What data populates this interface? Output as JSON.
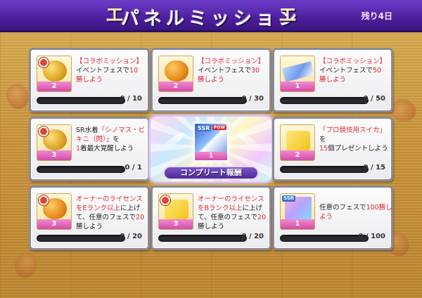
{
  "header": {
    "title": "パネルミッション",
    "remaining": "残り4日",
    "deco_glyph": "エ"
  },
  "center": {
    "reward_count": "1",
    "ssr_badge": "SSR",
    "pow_badge": "POW",
    "banner": "コンプリート報酬"
  },
  "missions": [
    {
      "icon": "gold-trophy-item",
      "has_timer": true,
      "count": "2",
      "desc": [
        "【コラボミッション】",
        "イベントフェスで",
        "10",
        "勝しよう"
      ],
      "progress": "0 / 10",
      "fill": 0
    },
    {
      "icon": "melon-item",
      "has_timer": false,
      "count": "2",
      "desc": [
        "【コラボミッション】",
        "イベントフェスで",
        "30",
        "勝しよう"
      ],
      "progress": "0 / 30",
      "fill": 0
    },
    {
      "icon": "ssr-ticket-item",
      "has_timer": false,
      "count": "1",
      "ssr": "SSR",
      "desc": [
        "【コラボミッション】",
        "イベントフェスで",
        "50",
        "勝しよう"
      ],
      "progress": "0 / 50",
      "fill": 0
    },
    {
      "icon": "gold-trophy-item",
      "has_timer": true,
      "count": "3",
      "desc": [
        "SR水着",
        "「シノマス・ビキニ（閃）」",
        "を",
        "1",
        "着",
        "最大覚醒しよう"
      ],
      "progress": "0 / 1",
      "fill": 0
    },
    {
      "icon": "heart-gift-item",
      "has_timer": false,
      "count": "2",
      "desc": [
        "「プロ競技用スイカ」",
        "を",
        "15",
        "個",
        "プレゼントしよう"
      ],
      "progress": "0 / 15",
      "fill": 0
    },
    {
      "icon": "melon-item",
      "has_timer": true,
      "count": "3",
      "desc": [
        "オーナーのライセンスをEランク以上",
        "に上げて、任意のフェスで",
        "20",
        "勝しよう"
      ],
      "progress": "0 / 20",
      "fill": 0
    },
    {
      "icon": "heart-gift-item",
      "has_timer": true,
      "count": "3",
      "desc": [
        "オーナーのライセンスをBランク以上",
        "に上げて、任意のフェスで",
        "20",
        "勝しよう"
      ],
      "progress": "0 / 20",
      "fill": 0
    },
    {
      "icon": "ssr-card-item",
      "has_timer": false,
      "count": "1",
      "ssr": "SSR",
      "desc": [
        "任意のフェスで",
        "100",
        "勝しよう"
      ],
      "progress": "0 / 100",
      "fill": 0
    }
  ]
}
